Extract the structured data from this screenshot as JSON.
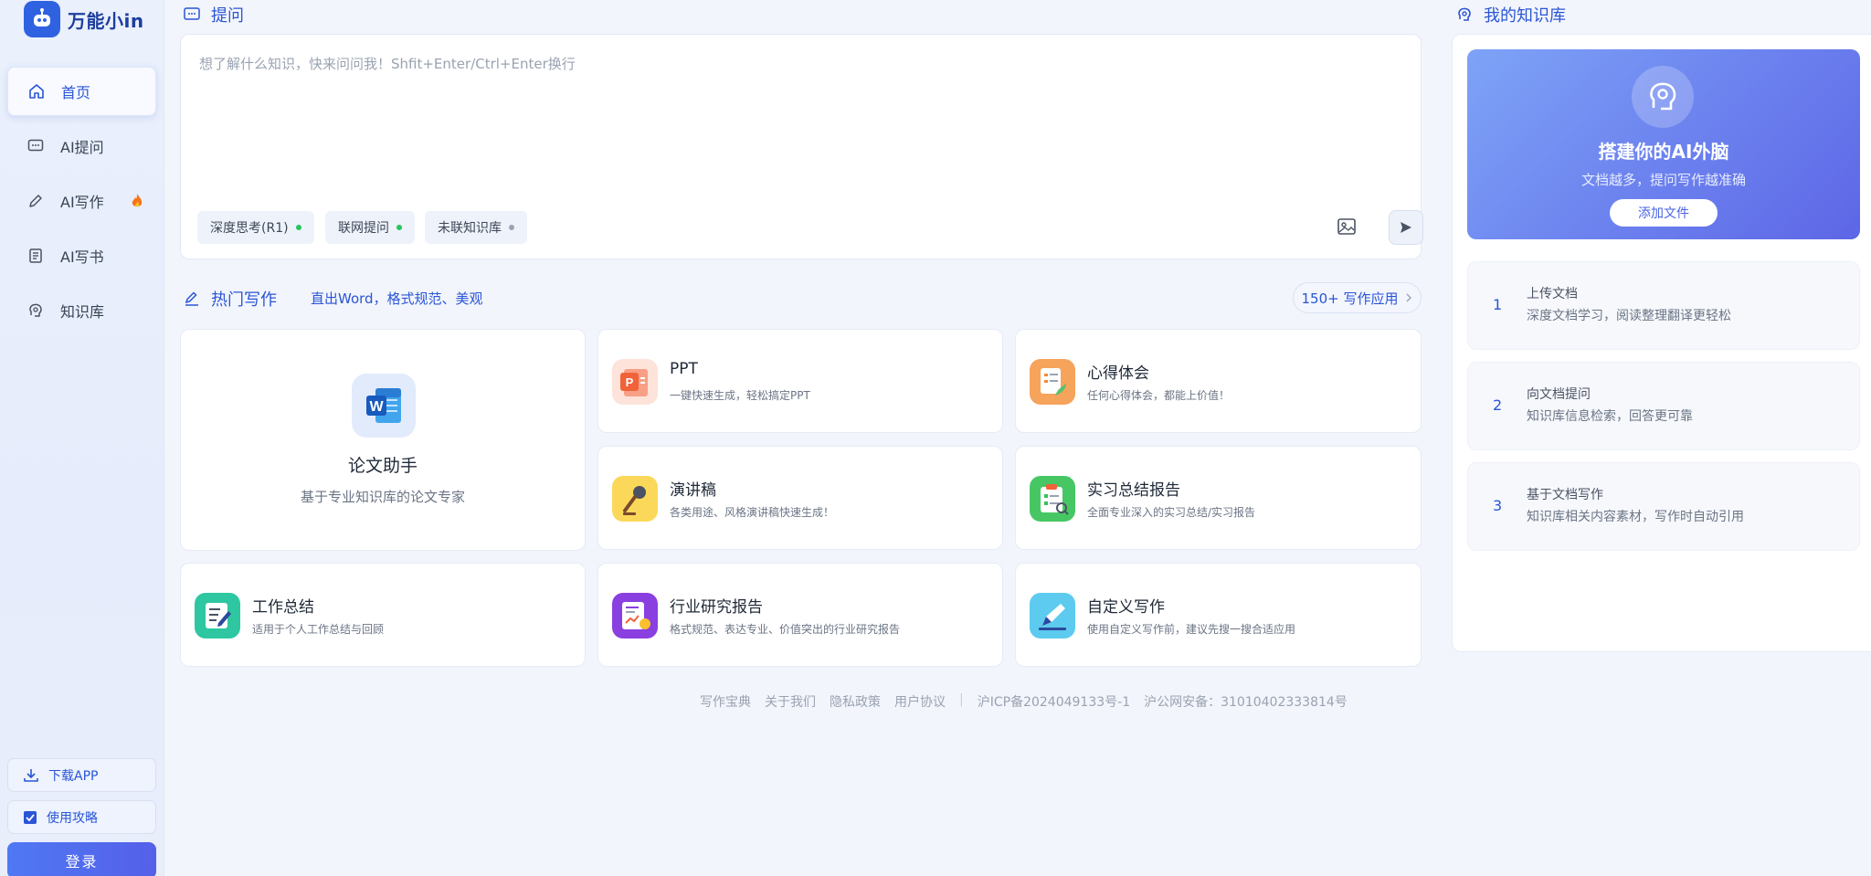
{
  "app": {
    "name": "万能小in"
  },
  "sidebar": {
    "items": [
      {
        "label": "首页",
        "icon": "home-icon",
        "active": true
      },
      {
        "label": "AI提问",
        "icon": "chat-icon"
      },
      {
        "label": "AI写作",
        "icon": "pen-icon",
        "badge": "fire-icon"
      },
      {
        "label": "AI写书",
        "icon": "book-icon"
      },
      {
        "label": "知识库",
        "icon": "brain-icon"
      }
    ],
    "download_app": "下载APP",
    "guide": "使用攻略",
    "login": "登录"
  },
  "ask": {
    "title": "提问",
    "placeholder": "想了解什么知识，快来问问我！Shfit+Enter/Ctrl+Enter换行",
    "chips": [
      {
        "label": "深度思考(R1)",
        "status_color": "#22c55e"
      },
      {
        "label": "联网提问",
        "status_color": "#22c55e"
      },
      {
        "label": "未联知识库",
        "status_color": "#9ca3af"
      }
    ]
  },
  "hot_writing": {
    "title": "热门写作",
    "subtitle": "直出Word，格式规范、美观",
    "apps_button": "150+ 写作应用",
    "featured": {
      "title": "论文助手",
      "desc": "基于专业知识库的论文专家",
      "icon": "word-icon"
    },
    "cards": [
      {
        "title": "PPT",
        "desc": "一键快速生成，轻松搞定PPT",
        "icon": "ppt-icon",
        "color": "#f0623a",
        "bg": "#fde3da"
      },
      {
        "title": "心得体会",
        "desc": "任何心得体会，都能上价值！",
        "icon": "notes-icon",
        "color": "#f08a3a",
        "bg": "#fbd3b3"
      },
      {
        "title": "演讲稿",
        "desc": "各类用途、风格演讲稿快速生成！",
        "icon": "microphone-icon",
        "color": "#f1c232",
        "bg": "#fbe7a3"
      },
      {
        "title": "实习总结报告",
        "desc": "全面专业深入的实习总结/实习报告",
        "icon": "clipboard-icon",
        "color": "#36c25a",
        "bg": "#c9f0d2"
      },
      {
        "title": "工作总结",
        "desc": "适用于个人工作总结与回顾",
        "icon": "edit-icon",
        "color": "#1fbf97",
        "bg": "#c7efe3"
      },
      {
        "title": "行业研究报告",
        "desc": "格式规范、表达专业、价值突出的行业研究报告",
        "icon": "report-icon",
        "color": "#8a3fe0",
        "bg": "#e4d3fa"
      },
      {
        "title": "自定义写作",
        "desc": "使用自定义写作前，建议先搜一搜合适应用",
        "icon": "custom-write-icon",
        "color": "#3ab5e0",
        "bg": "#cdeefa"
      }
    ]
  },
  "footer": {
    "links": [
      "写作宝典",
      "关于我们",
      "隐私政策",
      "用户协议"
    ],
    "separator": "|",
    "icp": "沪ICP备2024049133号-1",
    "police": "沪公网安备：31010402333814号"
  },
  "knowledge": {
    "title": "我的知识库",
    "hero_title": "搭建你的AI外脑",
    "hero_sub": "文档越多，提问写作越准确",
    "add_button": "添加文件",
    "steps": [
      {
        "num": "1",
        "title": "上传文档",
        "desc": "深度文档学习，阅读整理翻译更轻松"
      },
      {
        "num": "2",
        "title": "向文档提问",
        "desc": "知识库信息检索，回答更可靠"
      },
      {
        "num": "3",
        "title": "基于文档写作",
        "desc": "知识库相关内容素材，写作时自动引用"
      }
    ]
  }
}
